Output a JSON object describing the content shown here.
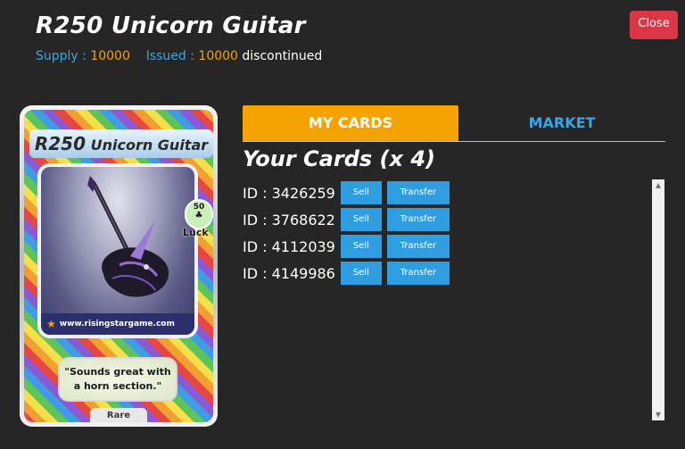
{
  "header": {
    "title": "R250 Unicorn Guitar",
    "supply_label": "Supply :",
    "supply_value": "10000",
    "issued_label": "Issued :",
    "issued_value": "10000",
    "status": "discontinued",
    "close_label": "Close"
  },
  "card": {
    "name_number": "R250",
    "name_text": "Unicorn Guitar",
    "luck_value": "50",
    "luck_label": "Luck",
    "url": "www.risingstargame.com",
    "quote": "\"Sounds great with a horn section.\"",
    "rarity": "Rare"
  },
  "tabs": [
    {
      "label": "MY CARDS",
      "active": true
    },
    {
      "label": "MARKET",
      "active": false
    }
  ],
  "your_cards_heading": "Your Cards (x 4)",
  "cards": [
    {
      "id_label": "ID : 3426259",
      "sell": "Sell",
      "transfer": "Transfer"
    },
    {
      "id_label": "ID : 3768622",
      "sell": "Sell",
      "transfer": "Transfer"
    },
    {
      "id_label": "ID : 4112039",
      "sell": "Sell",
      "transfer": "Transfer"
    },
    {
      "id_label": "ID : 4149986",
      "sell": "Sell",
      "transfer": "Transfer"
    }
  ],
  "colors": {
    "background": "#262626",
    "accent_orange": "#f4a300",
    "accent_blue": "#3aa5e6",
    "close_red": "#dc3545"
  },
  "icons": [
    "star-icon",
    "clover-icon",
    "scroll-up-arrow-icon",
    "scroll-down-arrow-icon"
  ]
}
